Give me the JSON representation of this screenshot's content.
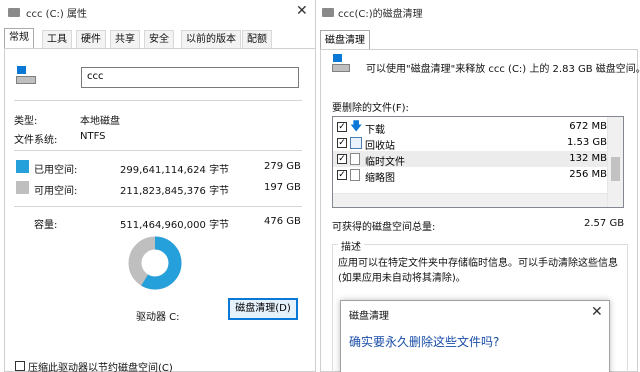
{
  "left_window": {
    "title": "ccc (C:) 属性",
    "tabs": [
      "常规",
      "工具",
      "硬件",
      "共享",
      "安全",
      "以前的版本",
      "配额"
    ],
    "volume_name": "ccc",
    "type_label": "类型:",
    "type_value": "本地磁盘",
    "fs_label": "文件系统:",
    "fs_value": "NTFS",
    "used_label": "已用空间:",
    "used_bytes": "299,641,114,624 字节",
    "used_gb": "279 GB",
    "free_label": "可用空间:",
    "free_bytes": "211,823,845,376 字节",
    "free_gb": "197 GB",
    "cap_label": "容量:",
    "cap_bytes": "511,464,960,000 字节",
    "cap_gb": "476 GB",
    "drive_label": "驱动器 C:",
    "cleanup_button": "磁盘清理(D)",
    "compress_label": "压缩此驱动器以节约磁盘空间(C)",
    "used_fraction": 0.586,
    "colors": {
      "used": "#26a0da",
      "free": "#bfbfbf",
      "accent": "#0a78d4"
    },
    "icons": [
      "window-icon",
      "close-icon",
      "drive-icon"
    ]
  },
  "right_window": {
    "title": "ccc(C:)的磁盘清理",
    "tab": "磁盘清理",
    "intro": "可以使用\"磁盘清理\"来释放 ccc (C:) 上的 2.83 GB 磁盘空间。",
    "files_label": "要删除的文件(F):",
    "files": [
      {
        "name": "下载",
        "size": "672 MB",
        "checked": true,
        "icon": "download-arrow-icon"
      },
      {
        "name": "回收站",
        "size": "1.53 GB",
        "checked": true,
        "icon": "recycle-bin-icon"
      },
      {
        "name": "临时文件",
        "size": "132 MB",
        "checked": true,
        "icon": "file-icon"
      },
      {
        "name": "缩略图",
        "size": "256 MB",
        "checked": true,
        "icon": "file-icon"
      }
    ],
    "gain_label": "可获得的磁盘空间总量:",
    "gain_value": "2.57 GB",
    "desc_title": "描述",
    "desc_text": "应用可以在特定文件夹中存储临时信息。可以手动清除这些信息(如果应用未自动将其清除)。"
  },
  "dialog": {
    "title": "磁盘清理",
    "question": "确实要永久删除这些文件吗?"
  }
}
